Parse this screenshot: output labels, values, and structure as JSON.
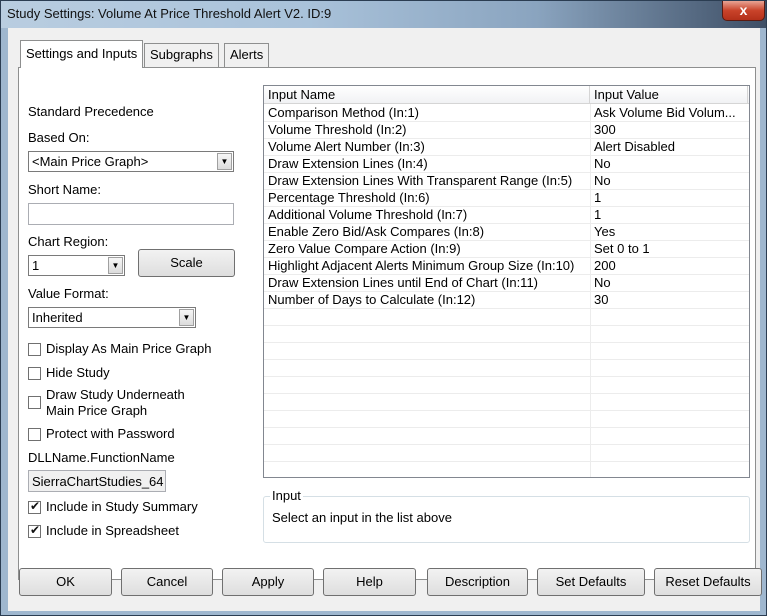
{
  "window": {
    "title": "Study Settings: Volume At Price Threshold Alert V2. ID:9",
    "close_label": "x"
  },
  "tabs": [
    {
      "label": "Settings and Inputs",
      "active": true
    },
    {
      "label": "Subgraphs",
      "active": false
    },
    {
      "label": "Alerts",
      "active": false
    }
  ],
  "left": {
    "standard_precedence": "Standard Precedence",
    "based_on_label": "Based On:",
    "based_on_value": "<Main Price Graph>",
    "short_name_label": "Short Name:",
    "short_name_value": "",
    "chart_region_label": "Chart Region:",
    "chart_region_value": "1",
    "scale_button": "Scale",
    "value_format_label": "Value Format:",
    "value_format_value": "Inherited",
    "checkboxes": {
      "display_as_main": {
        "label": "Display As Main Price Graph",
        "checked": false
      },
      "hide_study": {
        "label": "Hide Study",
        "checked": false
      },
      "draw_underneath_1": "Draw Study Underneath",
      "draw_underneath_2": "Main Price Graph",
      "draw_underneath_checked": false,
      "protect": {
        "label": "Protect with Password",
        "checked": false
      },
      "include_summary": {
        "label": "Include in Study Summary",
        "checked": true
      },
      "include_spreadsheet": {
        "label": "Include in Spreadsheet",
        "checked": true
      }
    },
    "dll_label": "DLLName.FunctionName",
    "dll_value": "SierraChartStudies_64"
  },
  "grid": {
    "headers": [
      "Input Name",
      "Input Value"
    ],
    "rows": [
      {
        "name": "Comparison Method   (In:1)",
        "value": "Ask Volume Bid Volum..."
      },
      {
        "name": "Volume Threshold   (In:2)",
        "value": "300"
      },
      {
        "name": "Volume Alert Number   (In:3)",
        "value": "Alert Disabled"
      },
      {
        "name": "Draw Extension Lines   (In:4)",
        "value": "No"
      },
      {
        "name": "Draw Extension Lines With Transparent Range   (In:5)",
        "value": "No"
      },
      {
        "name": "Percentage Threshold   (In:6)",
        "value": "1"
      },
      {
        "name": "Additional Volume Threshold   (In:7)",
        "value": "1"
      },
      {
        "name": "Enable Zero Bid/Ask Compares   (In:8)",
        "value": "Yes"
      },
      {
        "name": "Zero Value Compare Action   (In:9)",
        "value": "Set 0 to 1"
      },
      {
        "name": "Highlight Adjacent Alerts Minimum Group Size   (In:10)",
        "value": "200"
      },
      {
        "name": "Draw Extension Lines until End of Chart   (In:11)",
        "value": "No"
      },
      {
        "name": "Number of Days to Calculate   (In:12)",
        "value": "30"
      }
    ]
  },
  "input_group": {
    "legend": "Input",
    "description": "Select an input in the list above"
  },
  "buttons": {
    "ok": "OK",
    "cancel": "Cancel",
    "apply": "Apply",
    "help": "Help",
    "description": "Description",
    "set_defaults": "Set Defaults",
    "reset_defaults": "Reset Defaults"
  }
}
